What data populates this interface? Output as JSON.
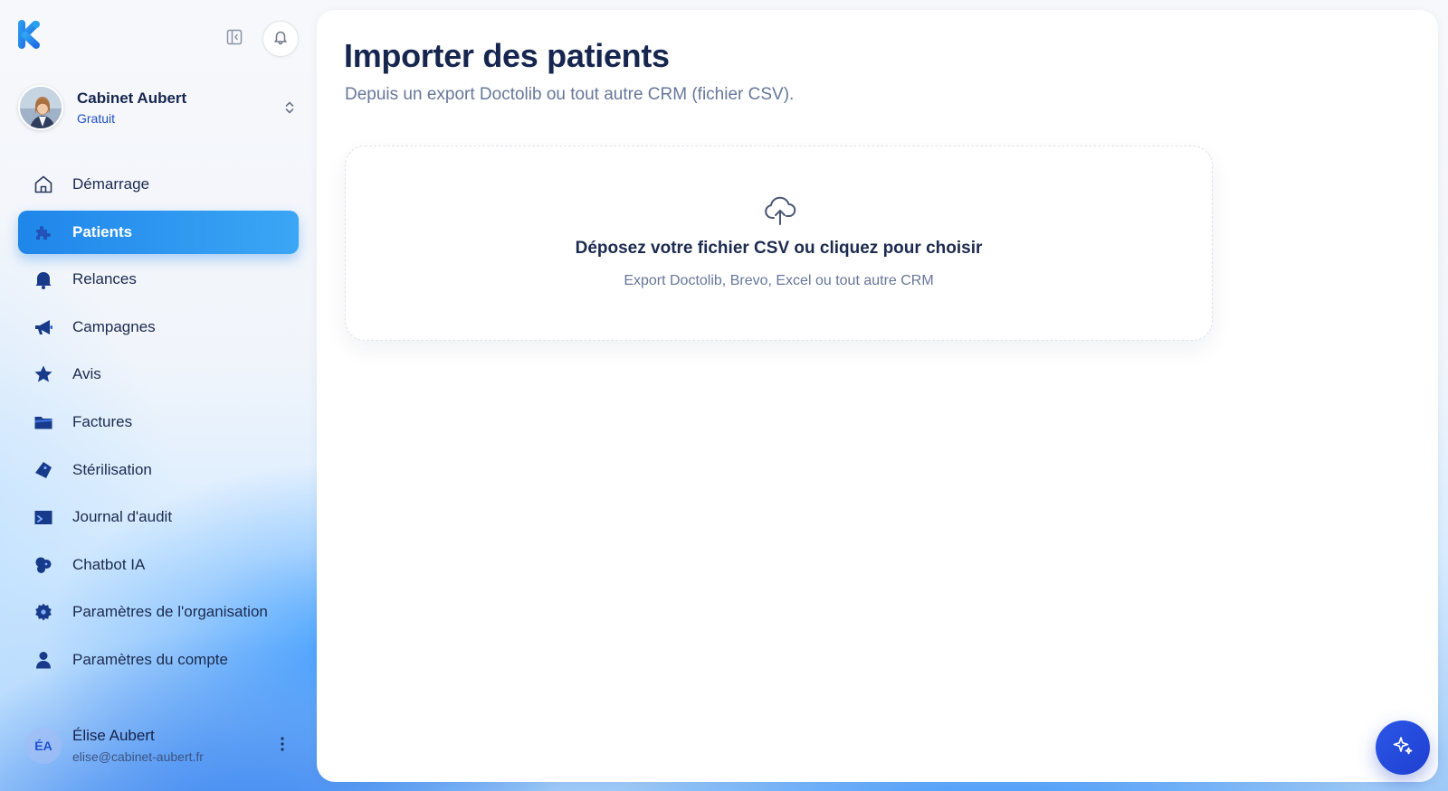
{
  "org": {
    "name": "Cabinet Aubert",
    "plan": "Gratuit"
  },
  "nav": {
    "items": [
      {
        "label": "Démarrage",
        "icon": "home-icon"
      },
      {
        "label": "Patients",
        "icon": "puzzle-icon",
        "active": true
      },
      {
        "label": "Relances",
        "icon": "bell-icon"
      },
      {
        "label": "Campagnes",
        "icon": "megaphone-icon"
      },
      {
        "label": "Avis",
        "icon": "star-icon"
      },
      {
        "label": "Factures",
        "icon": "folder-icon"
      },
      {
        "label": "Stérilisation",
        "icon": "tag-icon"
      },
      {
        "label": "Journal d'audit",
        "icon": "audit-folder-icon"
      },
      {
        "label": "Chatbot IA",
        "icon": "chatbot-icon"
      },
      {
        "label": "Paramètres de l'organisation",
        "icon": "gear-icon"
      },
      {
        "label": "Paramètres du compte",
        "icon": "user-icon"
      }
    ]
  },
  "user": {
    "initials": "ÉA",
    "name": "Élise Aubert",
    "email": "elise@cabinet-aubert.fr"
  },
  "main": {
    "title": "Importer des patients",
    "subtitle": "Depuis un export Doctolib ou tout autre CRM (fichier CSV).",
    "dropzone": {
      "title": "Déposez votre fichier CSV ou cliquez pour choisir",
      "subtitle": "Export Doctolib, Brevo, Excel ou tout autre CRM"
    }
  },
  "colors": {
    "accent": "#1f86ea",
    "text_dark": "#16264f",
    "text_muted": "#66779a",
    "fab": "#2b57e8"
  }
}
